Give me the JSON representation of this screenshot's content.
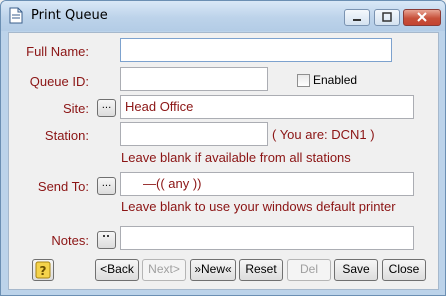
{
  "window": {
    "title": "Print Queue"
  },
  "fields": {
    "full_name": {
      "label": "Full Name:",
      "value": ""
    },
    "queue_id": {
      "label": "Queue ID:",
      "value": ""
    },
    "enabled": {
      "label": "Enabled",
      "checked": false
    },
    "site": {
      "label": "Site:",
      "value": "Head Office"
    },
    "station": {
      "label": "Station:",
      "value": "",
      "note": "( You are: DCN1 )",
      "hint": "Leave blank if available from all stations"
    },
    "send_to": {
      "label": "Send To:",
      "value": "—(( any ))",
      "hint": "Leave blank to use your windows default printer"
    },
    "notes": {
      "label": "Notes:",
      "value": ""
    }
  },
  "buttons": {
    "back": "<Back",
    "next": "Next>",
    "new": "»New«",
    "reset": "Reset",
    "del": "Del",
    "save": "Save",
    "close": "Close",
    "browse": "..."
  }
}
